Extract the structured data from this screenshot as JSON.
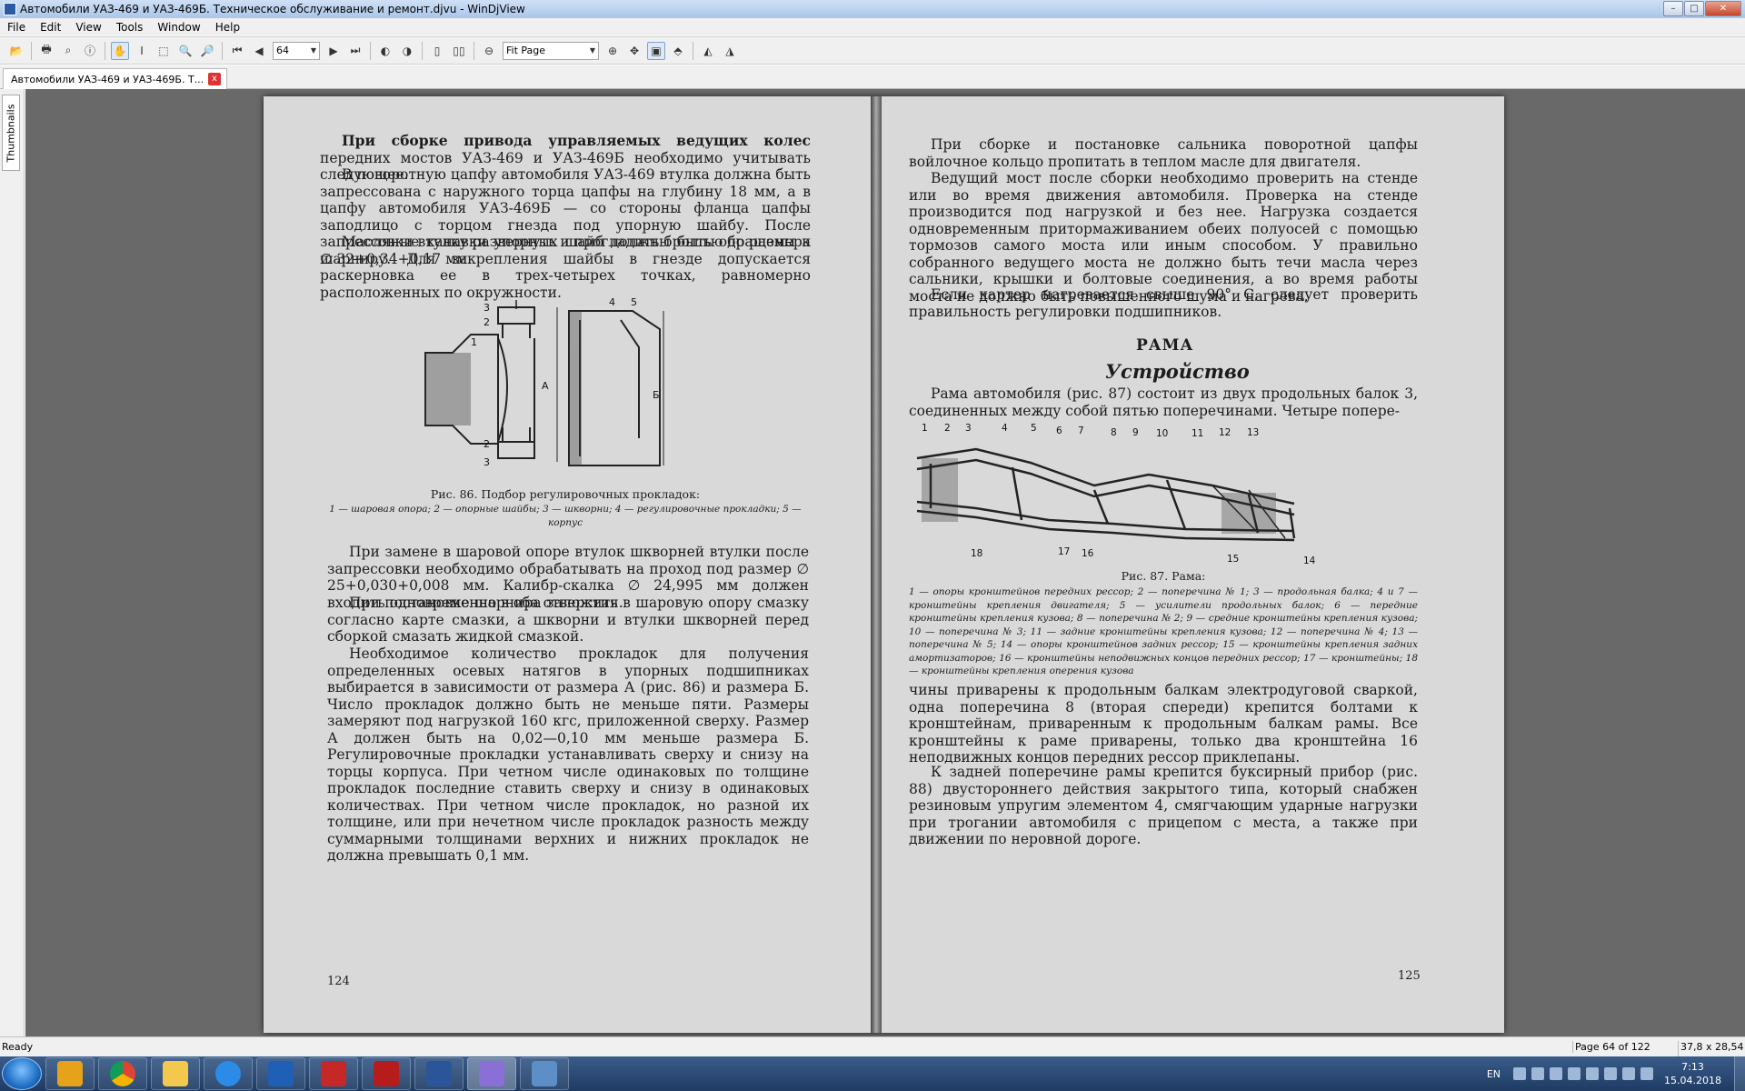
{
  "window": {
    "title": "Автомобили УАЗ-469 и УАЗ-469Б. Техническое обслуживание и ремонт.djvu - WinDjView",
    "min": "–",
    "max": "□",
    "close": "✕"
  },
  "menu": [
    "File",
    "Edit",
    "View",
    "Tools",
    "Window",
    "Help"
  ],
  "toolbar": {
    "page_value": "64",
    "zoom_value": "Fit Page"
  },
  "tab": {
    "label": "Автомобили УАЗ-469 и УАЗ-469Б. Т...",
    "close": "x"
  },
  "sidebar": {
    "thumbnails_label": "Thumbnails"
  },
  "doc": {
    "left": {
      "p1_bold": "При сборке привода управляемых ведущих колес",
      "p1_rest": " передних мостов УАЗ-469 и УАЗ-469Б необходимо учитывать следующее.",
      "p2": "В поворотную цапфу автомобиля УАЗ-469 втулка должна быть запрессована с наружного торца цапфы на глубину 18 мм, а в цапфу автомобиля УАЗ-469Б — со стороны фланца цапфы заподлицо с торцом гнезда под упорную шайбу. После запрессовки втулку развернуть и прогладить брошью до размера ∅ 32+0,34+0,17 мм.",
      "p3": "Масляные канавки упорных шайб должны быть обращены к шарниру. Для закрепления шайбы в гнезде допускается раскерновка ее в трех-четырех точках, равномерно расположенных по окружности.",
      "fig_caption": "Рис. 86. Подбор регулировочных прокладок:",
      "fig_legend": "1 — шаровая опора; 2 — опорные шайбы; 3 — шкворни; 4 — регулировочные прокладки; 5 — корпус",
      "fig_labels": [
        "3",
        "2",
        "1",
        "2",
        "3",
        "А",
        "4",
        "5",
        "Б"
      ],
      "p4": "При замене в шаровой опоре втулок шкворней втулки после запрессовки необходимо обрабатывать на проход под размер ∅ 25+0,030+0,008 мм. Калибр-скалка ∅ 24,995 мм должен входить одновременно в оба отверстия.",
      "p5": "При постановке шарнира заложить в шаровую опору смазку согласно карте смазки, а шкворни и втулки шкворней перед сборкой смазать жидкой смазкой.",
      "p6": "Необходимое количество прокладок для получения определенных осевых натягов в упорных подшипниках выбирается в зависимости от размера А (рис. 86) и размера Б. Число прокладок должно быть не меньше пяти. Размеры замеряют под нагрузкой 160 кгс, приложенной сверху. Размер А должен быть на 0,02—0,10 мм меньше размера Б. Регулировочные прокладки устанавливать сверху и снизу на торцы корпуса. При четном числе одинаковых по толщине прокладок последние ставить сверху и снизу в одинаковых количествах. При четном числе прокладок, но разной их толщине, или при нечетном числе прокладок разность между суммарными толщинами верхних и нижних прокладок не должна превышать 0,1 мм.",
      "page_number": "124"
    },
    "right": {
      "p1": "При сборке и постановке сальника поворотной цапфы войлочное кольцо пропитать в теплом масле для двигателя.",
      "p2": "Ведущий мост после сборки необходимо проверить на стенде или во время движения автомобиля. Проверка на стенде производится под нагрузкой и без нее. Нагрузка создается одновременным притормаживанием обеих полуосей с помощью тормозов самого моста или иным способом. У правильно собранного ведущего моста не должно быть течи масла через сальники, крышки и болтовые соединения, а во время работы моста не должно быть повышенного шума и нагрева.",
      "p3": "Если картер нагревается свыше 90° С, следует проверить правильность регулировки подшипников.",
      "heading1": "РАМА",
      "heading2": "Устройство",
      "p4": "Рама автомобиля (рис. 87) состоит из двух продольных балок 3, соединенных между собой пятью поперечинами. Четыре попере-",
      "fig_labels_top": [
        "1",
        "2",
        "3",
        "4",
        "5",
        "6",
        "7",
        "8",
        "9",
        "10",
        "11",
        "12",
        "13"
      ],
      "fig_labels_bottom": [
        "18",
        "17",
        "16",
        "15",
        "14"
      ],
      "fig_caption": "Рис. 87. Рама:",
      "fig_legend": "1 — опоры кронштейнов передних рессор; 2 — поперечина № 1; 3 — продольная балка; 4 и 7 — кронштейны крепления двигателя; 5 — усилители продольных балок; 6 — передние кронштейны крепления кузова; 8 — поперечина № 2; 9 — средние кронштейны крепления кузова; 10 — поперечина № 3; 11 — задние кронштейны крепления кузова; 12 — поперечина № 4; 13 — поперечина № 5; 14 — опоры кронштейнов задних рессор; 15 — кронштейны крепления задних амортизаторов; 16 — кронштейны неподвижных концов передних рессор; 17 — кронштейны; 18 — кронштейны крепления оперения кузова",
      "p5": "чины приварены к продольным балкам электродуговой сваркой, одна поперечина 8 (вторая спереди) крепится болтами к кронштейнам, приваренным к продольным балкам рамы. Все кронштейны к раме приварены, только два кронштейна 16 неподвижных концов передних рессор приклепаны.",
      "p6": "К задней поперечине рамы крепится буксирный прибор (рис. 88) двустороннего действия закрытого типа, который снабжен резиновым упругим элементом 4, смягчающим ударные нагрузки при трогании автомобиля с прицепом с места, а также при движении по неровной дороге.",
      "page_number": "125"
    }
  },
  "status": {
    "ready": "Ready",
    "page": "Page 64 of 122",
    "size": "37,8 x 28,54 cm"
  },
  "taskbar": {
    "apps": [
      "media-player",
      "chrome",
      "explorer",
      "internet-explorer",
      "outlook",
      "acrobat-distiller",
      "acrobat-reader",
      "word",
      "windjview",
      "image-viewer"
    ],
    "lang": "EN",
    "time": "7:13",
    "date": "15.04.2018"
  }
}
